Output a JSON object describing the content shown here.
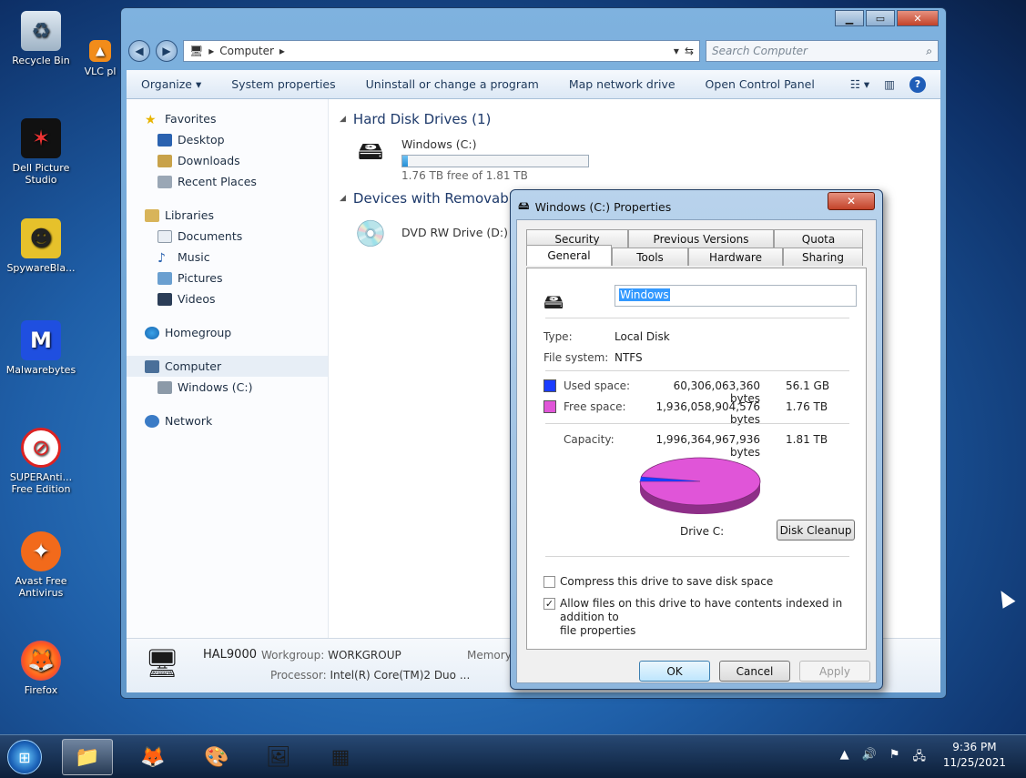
{
  "desktop": {
    "icons": [
      {
        "label": "Recycle Bin",
        "icon": "recycle-bin-icon"
      },
      {
        "label": "VLC pl",
        "icon": "vlc-icon"
      },
      {
        "label": "Dell Picture Studio",
        "icon": "dell-picture-studio-icon"
      },
      {
        "label": "SpywareBla...",
        "icon": "spywareblaster-icon"
      },
      {
        "label": "Malwarebytes",
        "icon": "malwarebytes-icon"
      },
      {
        "label": "SUPERAnti... Free Edition",
        "icon": "superantispyware-icon"
      },
      {
        "label": "Avast Free Antivirus",
        "icon": "avast-icon"
      },
      {
        "label": "Firefox",
        "icon": "firefox-icon"
      }
    ]
  },
  "explorer": {
    "breadcrumb": "Computer",
    "search_placeholder": "Search Computer",
    "toolbar": {
      "organize": "Organize",
      "system_properties": "System properties",
      "uninstall": "Uninstall or change a program",
      "map_drive": "Map network drive",
      "control_panel": "Open Control Panel"
    },
    "nav": {
      "favorites": "Favorites",
      "desktop": "Desktop",
      "downloads": "Downloads",
      "recent": "Recent Places",
      "libraries": "Libraries",
      "documents": "Documents",
      "music": "Music",
      "pictures": "Pictures",
      "videos": "Videos",
      "homegroup": "Homegroup",
      "computer": "Computer",
      "windows_c": "Windows (C:)",
      "network": "Network"
    },
    "groups": {
      "hdd": "Hard Disk Drives (1)",
      "removable": "Devices with Removable"
    },
    "drives": {
      "c_name": "Windows (C:)",
      "c_free": "1.76 TB free of 1.81 TB",
      "c_used_fraction": 0.03,
      "dvd_name": "DVD RW Drive (D:)"
    },
    "details": {
      "hostname": "HAL9000",
      "workgroup_label": "Workgroup:",
      "workgroup": "WORKGROUP",
      "processor_label": "Processor:",
      "processor": "Intel(R) Core(TM)2 Duo ...",
      "memory_label": "Memory"
    }
  },
  "dialog": {
    "title": "Windows (C:) Properties",
    "tabs_back": [
      "Security",
      "Previous Versions",
      "Quota"
    ],
    "tabs_front": [
      "General",
      "Tools",
      "Hardware",
      "Sharing"
    ],
    "name_value": "Windows",
    "type_label": "Type:",
    "type_value": "Local Disk",
    "fs_label": "File system:",
    "fs_value": "NTFS",
    "used_label": "Used space:",
    "used_bytes": "60,306,063,360 bytes",
    "used_size": "56.1 GB",
    "free_label": "Free space:",
    "free_bytes": "1,936,058,904,576 bytes",
    "free_size": "1.76 TB",
    "cap_label": "Capacity:",
    "cap_bytes": "1,996,364,967,936 bytes",
    "cap_size": "1.81 TB",
    "drive_label": "Drive C:",
    "used_fraction": 0.0302,
    "used_color": "#1a3cff",
    "free_color": "#e055d8",
    "disk_cleanup": "Disk Cleanup",
    "compress_label": "Compress this drive to save disk space",
    "index_label_1": "Allow files on this drive to have contents indexed in addition to",
    "index_label_2": "file properties",
    "ok": "OK",
    "cancel": "Cancel",
    "apply": "Apply"
  },
  "taskbar": {
    "time": "9:36 PM",
    "date": "11/25/2021"
  }
}
